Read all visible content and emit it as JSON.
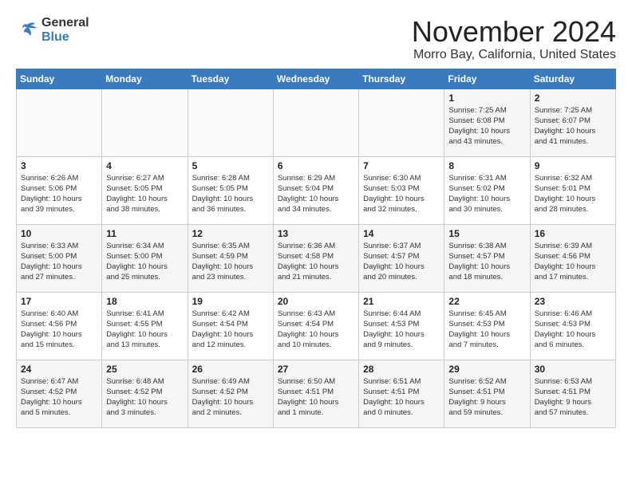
{
  "header": {
    "logo_general": "General",
    "logo_blue": "Blue",
    "month": "November 2024",
    "location": "Morro Bay, California, United States"
  },
  "weekdays": [
    "Sunday",
    "Monday",
    "Tuesday",
    "Wednesday",
    "Thursday",
    "Friday",
    "Saturday"
  ],
  "weeks": [
    [
      {
        "day": "",
        "info": ""
      },
      {
        "day": "",
        "info": ""
      },
      {
        "day": "",
        "info": ""
      },
      {
        "day": "",
        "info": ""
      },
      {
        "day": "",
        "info": ""
      },
      {
        "day": "1",
        "info": "Sunrise: 7:25 AM\nSunset: 6:08 PM\nDaylight: 10 hours\nand 43 minutes."
      },
      {
        "day": "2",
        "info": "Sunrise: 7:25 AM\nSunset: 6:07 PM\nDaylight: 10 hours\nand 41 minutes."
      }
    ],
    [
      {
        "day": "3",
        "info": "Sunrise: 6:26 AM\nSunset: 5:06 PM\nDaylight: 10 hours\nand 39 minutes."
      },
      {
        "day": "4",
        "info": "Sunrise: 6:27 AM\nSunset: 5:05 PM\nDaylight: 10 hours\nand 38 minutes."
      },
      {
        "day": "5",
        "info": "Sunrise: 6:28 AM\nSunset: 5:05 PM\nDaylight: 10 hours\nand 36 minutes."
      },
      {
        "day": "6",
        "info": "Sunrise: 6:29 AM\nSunset: 5:04 PM\nDaylight: 10 hours\nand 34 minutes."
      },
      {
        "day": "7",
        "info": "Sunrise: 6:30 AM\nSunset: 5:03 PM\nDaylight: 10 hours\nand 32 minutes."
      },
      {
        "day": "8",
        "info": "Sunrise: 6:31 AM\nSunset: 5:02 PM\nDaylight: 10 hours\nand 30 minutes."
      },
      {
        "day": "9",
        "info": "Sunrise: 6:32 AM\nSunset: 5:01 PM\nDaylight: 10 hours\nand 28 minutes."
      }
    ],
    [
      {
        "day": "10",
        "info": "Sunrise: 6:33 AM\nSunset: 5:00 PM\nDaylight: 10 hours\nand 27 minutes."
      },
      {
        "day": "11",
        "info": "Sunrise: 6:34 AM\nSunset: 5:00 PM\nDaylight: 10 hours\nand 25 minutes."
      },
      {
        "day": "12",
        "info": "Sunrise: 6:35 AM\nSunset: 4:59 PM\nDaylight: 10 hours\nand 23 minutes."
      },
      {
        "day": "13",
        "info": "Sunrise: 6:36 AM\nSunset: 4:58 PM\nDaylight: 10 hours\nand 21 minutes."
      },
      {
        "day": "14",
        "info": "Sunrise: 6:37 AM\nSunset: 4:57 PM\nDaylight: 10 hours\nand 20 minutes."
      },
      {
        "day": "15",
        "info": "Sunrise: 6:38 AM\nSunset: 4:57 PM\nDaylight: 10 hours\nand 18 minutes."
      },
      {
        "day": "16",
        "info": "Sunrise: 6:39 AM\nSunset: 4:56 PM\nDaylight: 10 hours\nand 17 minutes."
      }
    ],
    [
      {
        "day": "17",
        "info": "Sunrise: 6:40 AM\nSunset: 4:56 PM\nDaylight: 10 hours\nand 15 minutes."
      },
      {
        "day": "18",
        "info": "Sunrise: 6:41 AM\nSunset: 4:55 PM\nDaylight: 10 hours\nand 13 minutes."
      },
      {
        "day": "19",
        "info": "Sunrise: 6:42 AM\nSunset: 4:54 PM\nDaylight: 10 hours\nand 12 minutes."
      },
      {
        "day": "20",
        "info": "Sunrise: 6:43 AM\nSunset: 4:54 PM\nDaylight: 10 hours\nand 10 minutes."
      },
      {
        "day": "21",
        "info": "Sunrise: 6:44 AM\nSunset: 4:53 PM\nDaylight: 10 hours\nand 9 minutes."
      },
      {
        "day": "22",
        "info": "Sunrise: 6:45 AM\nSunset: 4:53 PM\nDaylight: 10 hours\nand 7 minutes."
      },
      {
        "day": "23",
        "info": "Sunrise: 6:46 AM\nSunset: 4:53 PM\nDaylight: 10 hours\nand 6 minutes."
      }
    ],
    [
      {
        "day": "24",
        "info": "Sunrise: 6:47 AM\nSunset: 4:52 PM\nDaylight: 10 hours\nand 5 minutes."
      },
      {
        "day": "25",
        "info": "Sunrise: 6:48 AM\nSunset: 4:52 PM\nDaylight: 10 hours\nand 3 minutes."
      },
      {
        "day": "26",
        "info": "Sunrise: 6:49 AM\nSunset: 4:52 PM\nDaylight: 10 hours\nand 2 minutes."
      },
      {
        "day": "27",
        "info": "Sunrise: 6:50 AM\nSunset: 4:51 PM\nDaylight: 10 hours\nand 1 minute."
      },
      {
        "day": "28",
        "info": "Sunrise: 6:51 AM\nSunset: 4:51 PM\nDaylight: 10 hours\nand 0 minutes."
      },
      {
        "day": "29",
        "info": "Sunrise: 6:52 AM\nSunset: 4:51 PM\nDaylight: 9 hours\nand 59 minutes."
      },
      {
        "day": "30",
        "info": "Sunrise: 6:53 AM\nSunset: 4:51 PM\nDaylight: 9 hours\nand 57 minutes."
      }
    ]
  ]
}
